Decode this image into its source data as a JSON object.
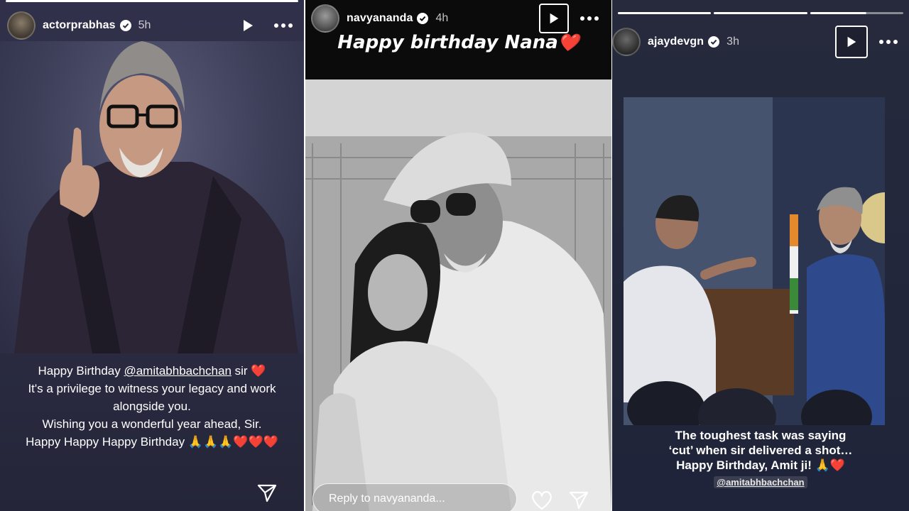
{
  "stories": [
    {
      "username": "actorprabhas",
      "time": "5h",
      "caption": {
        "line1_prefix": "Happy Birthday ",
        "line1_mention": "@amitabhbachchan",
        "line1_suffix": " sir",
        "line1_emoji": "❤️",
        "line2": "It's a privilege to witness your legacy and work",
        "line3": "alongside you.",
        "line4": "Wishing you a wonderful year ahead, Sir.",
        "line5": "Happy Happy Happy Birthday",
        "line5_pray": "🙏🙏🙏",
        "line5_hearts": "❤️❤️❤️"
      },
      "icons": [
        "verified-badge-icon",
        "play-icon",
        "more-icon",
        "share-icon"
      ]
    },
    {
      "username": "navyananda",
      "time": "4h",
      "title_text": "Happy birthday Nana",
      "title_emoji": "❤️",
      "reply_placeholder": "Reply to navyananda...",
      "icons": [
        "verified-badge-icon",
        "play-icon",
        "more-icon",
        "heart-icon",
        "share-icon"
      ]
    },
    {
      "username": "ajaydevgn",
      "time": "3h",
      "caption": {
        "line1": "The toughest task was saying",
        "line2": "‘cut’ when sir delivered a shot…",
        "line3": "Happy Birthday, Amit ji!",
        "line3_emojis": "🙏❤️"
      },
      "mention": "@amitabhbachchan",
      "icons": [
        "verified-badge-icon",
        "play-icon",
        "more-icon"
      ]
    }
  ],
  "colors": {
    "verified": "#3897f0",
    "heart": "#e0211f",
    "story1_bg": "#2b2c43",
    "story2_bg": "#0b0b0b",
    "story3_bg": "#20243a"
  }
}
